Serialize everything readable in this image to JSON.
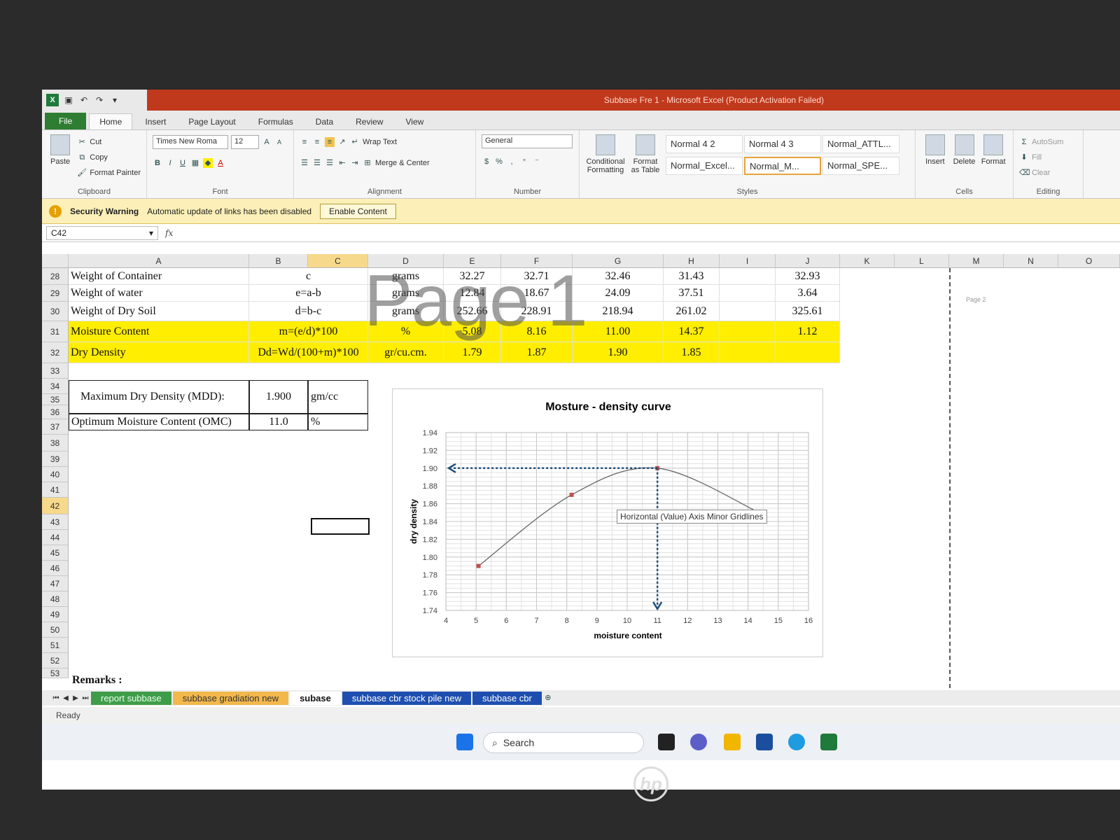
{
  "window": {
    "title": "Subbase Fre 1  -  Microsoft Excel (Product Activation Failed)"
  },
  "ribbon_tabs": [
    "File",
    "Home",
    "Insert",
    "Page Layout",
    "Formulas",
    "Data",
    "Review",
    "View"
  ],
  "ribbon": {
    "clipboard": {
      "paste": "Paste",
      "cut": "Cut",
      "copy": "Copy",
      "format_painter": "Format Painter",
      "label": "Clipboard"
    },
    "font": {
      "name": "Times New Roma",
      "size": "12",
      "label": "Font"
    },
    "alignment": {
      "wrap": "Wrap Text",
      "merge": "Merge & Center",
      "label": "Alignment"
    },
    "number": {
      "format": "General",
      "label": "Number"
    },
    "styles": {
      "conditional": "Conditional Formatting",
      "format_table": "Format as Table",
      "items": [
        "Normal 4 2",
        "Normal 4 3",
        "Normal_ATTL...",
        "Normal_Excel...",
        "Normal_M...",
        "Normal_SPE..."
      ],
      "label": "Styles"
    },
    "cells": {
      "insert": "Insert",
      "delete": "Delete",
      "format": "Format",
      "label": "Cells"
    },
    "editing": {
      "autosum": "AutoSum",
      "fill": "Fill",
      "clear": "Clear",
      "label": "Editing"
    }
  },
  "security": {
    "title": "Security Warning",
    "message": "Automatic update of links has been disabled",
    "button": "Enable Content"
  },
  "formula_bar": {
    "name_box": "C42",
    "fx": "fx",
    "value": ""
  },
  "columns": [
    "A",
    "B",
    "C",
    "D",
    "E",
    "F",
    "G",
    "H",
    "I",
    "J",
    "K",
    "L",
    "M",
    "N",
    "O"
  ],
  "watermark": "Page 1",
  "page2_label": "Page 2",
  "rows": {
    "r28": {
      "num": "28",
      "a": "Weight of Container",
      "b": "c",
      "d": "grams",
      "e": "32.27",
      "f": "32.71",
      "g": "32.46",
      "h": "31.43",
      "j": "32.93"
    },
    "r29": {
      "num": "29",
      "a": "Weight of water",
      "b": "e=a-b",
      "d": "grams",
      "e": "12.84",
      "f": "18.67",
      "g": "24.09",
      "h": "37.51",
      "j": "3.64"
    },
    "r30": {
      "num": "30",
      "a": "Weight of Dry Soil",
      "b": "d=b-c",
      "d": "grams",
      "e": "252.66",
      "f": "228.91",
      "g": "218.94",
      "h": "261.02",
      "j": "325.61"
    },
    "r31": {
      "num": "31",
      "a": "Moisture Content",
      "b": "m=(e/d)*100",
      "d": "%",
      "e": "5.08",
      "f": "8.16",
      "g": "11.00",
      "h": "14.37",
      "j": "1.12"
    },
    "r32": {
      "num": "32",
      "a": "Dry Density",
      "b": "Dd=Wd/(100+m)*100",
      "d": "gr/cu.cm.",
      "e": "1.79",
      "f": "1.87",
      "g": "1.90",
      "h": "1.85",
      "j": ""
    }
  },
  "summary": {
    "mdd_label": "Maximum Dry Density (MDD):",
    "mdd_value": "1.900",
    "mdd_unit": "gm/cc",
    "omc_label": "Optimum Moisture Content (OMC)",
    "omc_value": "11.0",
    "omc_unit": "%"
  },
  "row_numbers_rest": [
    "33",
    "34",
    "35",
    "36",
    "37",
    "38",
    "39",
    "40",
    "41",
    "42",
    "43",
    "44",
    "45",
    "46",
    "47",
    "48",
    "49",
    "50",
    "51",
    "52",
    "53"
  ],
  "remarks": "Remarks :",
  "chart_data": {
    "type": "line",
    "title": "Mosture - density curve",
    "xlabel": "moisture content",
    "ylabel": "dry density",
    "xlim": [
      4,
      16
    ],
    "ylim": [
      1.74,
      1.94
    ],
    "x_ticks": [
      "4",
      "5",
      "6",
      "7",
      "8",
      "9",
      "10",
      "11",
      "12",
      "13",
      "14",
      "15",
      "16"
    ],
    "y_ticks": [
      "1.94",
      "1.92",
      "1.90",
      "1.88",
      "1.86",
      "1.84",
      "1.82",
      "1.80",
      "1.78",
      "1.76",
      "1.74"
    ],
    "series": [
      {
        "x": [
          5.08,
          8.16,
          11.0,
          14.37
        ],
        "y": [
          1.79,
          1.87,
          1.9,
          1.85
        ]
      }
    ],
    "optimum": {
      "x": 11.0,
      "y": 1.9
    },
    "grid": true,
    "line_color": "#666666",
    "marker_color": "#c0504d",
    "arrow_color": "#1f4e79",
    "tooltip": "Horizontal (Value) Axis Minor Gridlines"
  },
  "sheet_tabs": [
    "report subbase",
    "subbase gradiation new",
    "subase",
    "subbase cbr stock pile new",
    "subbase cbr"
  ],
  "status": "Ready",
  "taskbar": {
    "search": "Search"
  }
}
